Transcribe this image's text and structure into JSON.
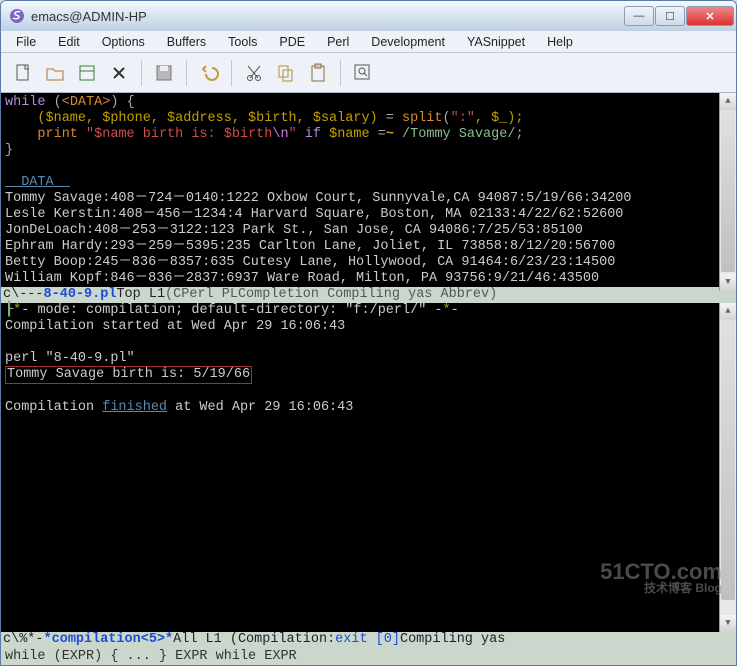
{
  "window": {
    "title": "emacs@ADMIN-HP"
  },
  "menu": {
    "file": "File",
    "edit": "Edit",
    "options": "Options",
    "buffers": "Buffers",
    "tools": "Tools",
    "pde": "PDE",
    "perl": "Perl",
    "development": "Development",
    "yasnippet": "YASnippet",
    "help": "Help"
  },
  "code": {
    "while": "while",
    "data": "<DATA>",
    "vars_line_pre": "($name, $phone, $address, $birth, $salary) ",
    "split": "split",
    "split_arg": "\":\"",
    "split_tail": ", $_);",
    "print": "print",
    "print_str_a": "$name birth is: $birth",
    "print_esc": "\\n",
    "if": "if",
    "regex_lhs": "$name ",
    "tilde": "~",
    "regex": " /Tommy Savage/",
    "data_sep": "__DATA__",
    "lines": [
      "Tommy Savage:408－724－0140:1222 Oxbow Court, Sunnyvale,CA 94087:5/19/66:34200",
      "Lesle Kerstin:408－456－1234:4 Harvard Square, Boston, MA 02133:4/22/62:52600",
      "JonDeLoach:408－253－3122:123 Park St., San Jose, CA 94086:7/25/53:85100",
      "Ephram Hardy:293－259－5395:235 Carlton Lane, Joliet, IL 73858:8/12/20:56700",
      "Betty Boop:245－836－8357:635 Cutesy Lane, Hollywood, CA 91464:6/23/23:14500",
      "William Kopf:846－836－2837:6937 Ware Road, Milton, PA 93756:9/21/46:43500"
    ]
  },
  "modeline1": {
    "left": "c\\---  ",
    "buf": "8-40-9.pl",
    "mid": "     Top L1     ",
    "modes": "(CPerl PLCompletion Compiling yas Abbrev)"
  },
  "comp": {
    "mode_pre": "-",
    "mode_key": "*",
    "mode_line": "- mode: compilation; default-directory: \"f:/perl/\" -",
    "mode_key2": "*",
    "mode_tail": "-",
    "started": "Compilation started at Wed Apr 29 16:06:43",
    "cmd": "perl \"8-40-9.pl\"",
    "out": "Tommy Savage birth is: 5/19/66",
    "fin_a": "Compilation ",
    "fin_b": "finished",
    "fin_c": " at Wed Apr 29 16:06:43"
  },
  "modeline2": {
    "left": "c\\%*-  ",
    "buf": "*compilation<5>*",
    "mid": "   All L1     (Compilation:",
    "exit": "exit [0]",
    "tail": " Compiling yas"
  },
  "minibuf": {
    "text": "while  (EXPR) { ... }                         EXPR while EXPR "
  },
  "watermark": {
    "big": "51CTO.com",
    "small": "技术博客   Blog"
  }
}
